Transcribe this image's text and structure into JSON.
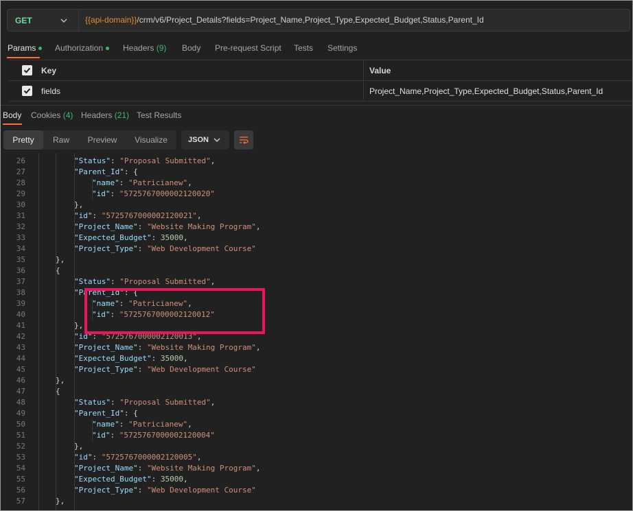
{
  "request": {
    "method": "GET",
    "url_variable": "{{api-domain}}",
    "url_path": "/crm/v6/Project_Details?fields=Project_Name,Project_Type,Expected_Budget,Status,Parent_Id"
  },
  "request_tabs": [
    {
      "label": "Params",
      "dot": true,
      "count": ""
    },
    {
      "label": "Authorization",
      "dot": true,
      "count": ""
    },
    {
      "label": "Headers",
      "dot": false,
      "count": "(9)"
    },
    {
      "label": "Body",
      "dot": false,
      "count": ""
    },
    {
      "label": "Pre-request Script",
      "dot": false,
      "count": ""
    },
    {
      "label": "Tests",
      "dot": false,
      "count": ""
    },
    {
      "label": "Settings",
      "dot": false,
      "count": ""
    }
  ],
  "params": {
    "key_header": "Key",
    "value_header": "Value",
    "rows": [
      {
        "key": "fields",
        "value": "Project_Name,Project_Type,Expected_Budget,Status,Parent_Id",
        "checked": true
      }
    ]
  },
  "response_tabs": [
    {
      "label": "Body",
      "count": ""
    },
    {
      "label": "Cookies",
      "count": "(4)"
    },
    {
      "label": "Headers",
      "count": "(21)"
    },
    {
      "label": "Test Results",
      "count": ""
    }
  ],
  "view_modes": [
    "Pretty",
    "Raw",
    "Preview",
    "Visualize"
  ],
  "active_view": "Pretty",
  "format": "JSON",
  "code_lines": [
    {
      "n": "26",
      "i": 2,
      "t": [
        [
          "k",
          "\"Status\""
        ],
        [
          "p",
          ": "
        ],
        [
          "s",
          "\"Proposal Submitted\""
        ],
        [
          "p",
          ","
        ]
      ]
    },
    {
      "n": "27",
      "i": 2,
      "t": [
        [
          "k",
          "\"Parent_Id\""
        ],
        [
          "p",
          ": {"
        ]
      ]
    },
    {
      "n": "28",
      "i": 3,
      "t": [
        [
          "k",
          "\"name\""
        ],
        [
          "p",
          ": "
        ],
        [
          "s",
          "\"Patricianew\""
        ],
        [
          "p",
          ","
        ]
      ]
    },
    {
      "n": "29",
      "i": 3,
      "t": [
        [
          "k",
          "\"id\""
        ],
        [
          "p",
          ": "
        ],
        [
          "s",
          "\"5725767000002120020\""
        ]
      ]
    },
    {
      "n": "30",
      "i": 2,
      "t": [
        [
          "p",
          "},"
        ]
      ]
    },
    {
      "n": "31",
      "i": 2,
      "t": [
        [
          "k",
          "\"id\""
        ],
        [
          "p",
          ": "
        ],
        [
          "s",
          "\"5725767000002120021\""
        ],
        [
          "p",
          ","
        ]
      ]
    },
    {
      "n": "32",
      "i": 2,
      "t": [
        [
          "k",
          "\"Project_Name\""
        ],
        [
          "p",
          ": "
        ],
        [
          "s",
          "\"Website Making Program\""
        ],
        [
          "p",
          ","
        ]
      ]
    },
    {
      "n": "33",
      "i": 2,
      "t": [
        [
          "k",
          "\"Expected_Budget\""
        ],
        [
          "p",
          ": "
        ],
        [
          "n",
          "35000"
        ],
        [
          "p",
          ","
        ]
      ]
    },
    {
      "n": "34",
      "i": 2,
      "t": [
        [
          "k",
          "\"Project_Type\""
        ],
        [
          "p",
          ": "
        ],
        [
          "s",
          "\"Web Development Course\""
        ]
      ]
    },
    {
      "n": "35",
      "i": 1,
      "t": [
        [
          "p",
          "},"
        ]
      ]
    },
    {
      "n": "36",
      "i": 1,
      "t": [
        [
          "p",
          "{"
        ]
      ]
    },
    {
      "n": "37",
      "i": 2,
      "t": [
        [
          "k",
          "\"Status\""
        ],
        [
          "p",
          ": "
        ],
        [
          "s",
          "\"Proposal Submitted\""
        ],
        [
          "p",
          ","
        ]
      ]
    },
    {
      "n": "38",
      "i": 2,
      "t": [
        [
          "k",
          "\"Parent_Id\""
        ],
        [
          "p",
          ": {"
        ]
      ]
    },
    {
      "n": "39",
      "i": 3,
      "t": [
        [
          "k",
          "\"name\""
        ],
        [
          "p",
          ": "
        ],
        [
          "s",
          "\"Patricianew\""
        ],
        [
          "p",
          ","
        ]
      ]
    },
    {
      "n": "40",
      "i": 3,
      "t": [
        [
          "k",
          "\"id\""
        ],
        [
          "p",
          ": "
        ],
        [
          "s",
          "\"5725767000002120012\""
        ]
      ]
    },
    {
      "n": "41",
      "i": 2,
      "t": [
        [
          "p",
          "},"
        ]
      ]
    },
    {
      "n": "42",
      "i": 2,
      "t": [
        [
          "k",
          "\"id\""
        ],
        [
          "p",
          ": "
        ],
        [
          "s",
          "\"5725767000002120013\""
        ],
        [
          "p",
          ","
        ]
      ]
    },
    {
      "n": "43",
      "i": 2,
      "t": [
        [
          "k",
          "\"Project_Name\""
        ],
        [
          "p",
          ": "
        ],
        [
          "s",
          "\"Website Making Program\""
        ],
        [
          "p",
          ","
        ]
      ]
    },
    {
      "n": "44",
      "i": 2,
      "t": [
        [
          "k",
          "\"Expected_Budget\""
        ],
        [
          "p",
          ": "
        ],
        [
          "n",
          "35000"
        ],
        [
          "p",
          ","
        ]
      ]
    },
    {
      "n": "45",
      "i": 2,
      "t": [
        [
          "k",
          "\"Project_Type\""
        ],
        [
          "p",
          ": "
        ],
        [
          "s",
          "\"Web Development Course\""
        ]
      ]
    },
    {
      "n": "46",
      "i": 1,
      "t": [
        [
          "p",
          "},"
        ]
      ]
    },
    {
      "n": "47",
      "i": 1,
      "t": [
        [
          "p",
          "{"
        ]
      ]
    },
    {
      "n": "48",
      "i": 2,
      "t": [
        [
          "k",
          "\"Status\""
        ],
        [
          "p",
          ": "
        ],
        [
          "s",
          "\"Proposal Submitted\""
        ],
        [
          "p",
          ","
        ]
      ]
    },
    {
      "n": "49",
      "i": 2,
      "t": [
        [
          "k",
          "\"Parent_Id\""
        ],
        [
          "p",
          ": {"
        ]
      ]
    },
    {
      "n": "50",
      "i": 3,
      "t": [
        [
          "k",
          "\"name\""
        ],
        [
          "p",
          ": "
        ],
        [
          "s",
          "\"Patricianew\""
        ],
        [
          "p",
          ","
        ]
      ]
    },
    {
      "n": "51",
      "i": 3,
      "t": [
        [
          "k",
          "\"id\""
        ],
        [
          "p",
          ": "
        ],
        [
          "s",
          "\"5725767000002120004\""
        ]
      ]
    },
    {
      "n": "52",
      "i": 2,
      "t": [
        [
          "p",
          "},"
        ]
      ]
    },
    {
      "n": "53",
      "i": 2,
      "t": [
        [
          "k",
          "\"id\""
        ],
        [
          "p",
          ": "
        ],
        [
          "s",
          "\"5725767000002120005\""
        ],
        [
          "p",
          ","
        ]
      ]
    },
    {
      "n": "54",
      "i": 2,
      "t": [
        [
          "k",
          "\"Project_Name\""
        ],
        [
          "p",
          ": "
        ],
        [
          "s",
          "\"Website Making Program\""
        ],
        [
          "p",
          ","
        ]
      ]
    },
    {
      "n": "55",
      "i": 2,
      "t": [
        [
          "k",
          "\"Expected_Budget\""
        ],
        [
          "p",
          ": "
        ],
        [
          "n",
          "35000"
        ],
        [
          "p",
          ","
        ]
      ]
    },
    {
      "n": "56",
      "i": 2,
      "t": [
        [
          "k",
          "\"Project_Type\""
        ],
        [
          "p",
          ": "
        ],
        [
          "s",
          "\"Web Development Course\""
        ]
      ]
    },
    {
      "n": "57",
      "i": 1,
      "t": [
        [
          "p",
          "},"
        ]
      ]
    }
  ],
  "colors": {
    "accent": "#ff6c37",
    "success_dot": "#3fb871",
    "method": "#6bdd9a",
    "url_variable": "#e28c35",
    "highlight_box": "#e8155f"
  },
  "icons": [
    "chevron-down-icon",
    "checkbox-checked-icon",
    "wrap-lines-icon"
  ]
}
